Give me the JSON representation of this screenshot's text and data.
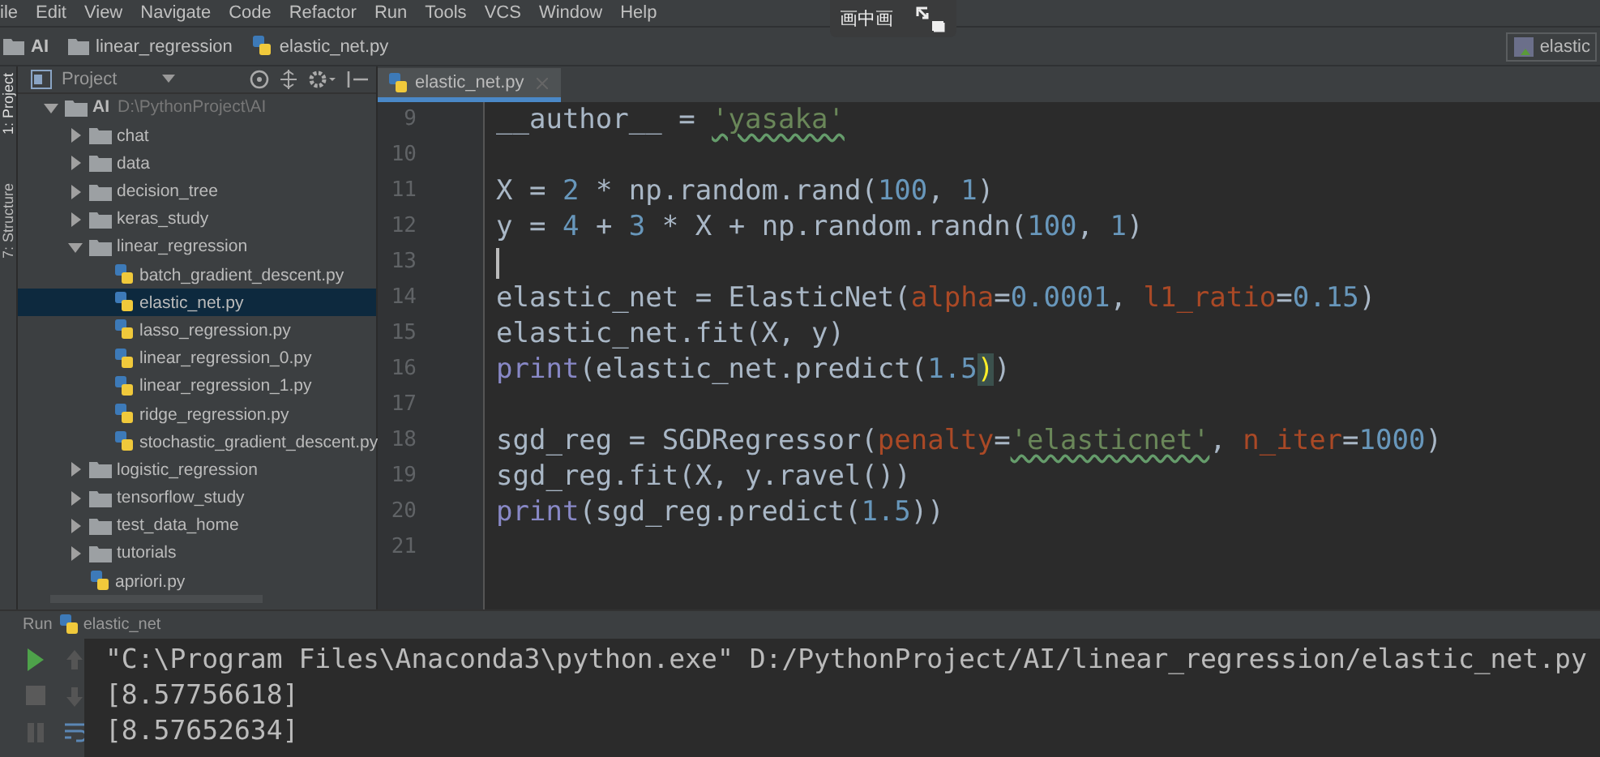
{
  "menu_bar": [
    "ile",
    "Edit",
    "View",
    "Navigate",
    "Code",
    "Refactor",
    "Run",
    "Tools",
    "VCS",
    "Window",
    "Help"
  ],
  "overlay": {
    "label": "画中画"
  },
  "breadcrumbs": [
    {
      "kind": "folder",
      "label": "AI"
    },
    {
      "kind": "folder",
      "label": "linear_regression"
    },
    {
      "kind": "file",
      "label": "elastic_net.py"
    }
  ],
  "run_config": {
    "label": "elastic"
  },
  "side_tabs": [
    "1: Project",
    "7: Structure"
  ],
  "project_panel": {
    "title": "Project",
    "tree": [
      {
        "kind": "folder",
        "label": "AI",
        "path": "D:\\PythonProject\\AI",
        "expanded": true,
        "selected": false,
        "children": [
          {
            "kind": "folder",
            "label": "chat",
            "expanded": false,
            "selected": false
          },
          {
            "kind": "folder",
            "label": "data",
            "expanded": false,
            "selected": false
          },
          {
            "kind": "folder",
            "label": "decision_tree",
            "expanded": false,
            "selected": false
          },
          {
            "kind": "folder",
            "label": "keras_study",
            "expanded": false,
            "selected": false
          },
          {
            "kind": "folder",
            "label": "linear_regression",
            "expanded": true,
            "selected": false,
            "children": [
              {
                "kind": "file",
                "label": "batch_gradient_descent.py",
                "selected": false
              },
              {
                "kind": "file",
                "label": "elastic_net.py",
                "selected": true
              },
              {
                "kind": "file",
                "label": "lasso_regression.py",
                "selected": false
              },
              {
                "kind": "file",
                "label": "linear_regression_0.py",
                "selected": false
              },
              {
                "kind": "file",
                "label": "linear_regression_1.py",
                "selected": false
              },
              {
                "kind": "file",
                "label": "ridge_regression.py",
                "selected": false
              },
              {
                "kind": "file",
                "label": "stochastic_gradient_descent.py",
                "selected": false
              }
            ]
          },
          {
            "kind": "folder",
            "label": "logistic_regression",
            "expanded": false,
            "selected": false
          },
          {
            "kind": "folder",
            "label": "tensorflow_study",
            "expanded": false,
            "selected": false
          },
          {
            "kind": "folder",
            "label": "test_data_home",
            "expanded": false,
            "selected": false
          },
          {
            "kind": "folder",
            "label": "tutorials",
            "expanded": false,
            "selected": false
          },
          {
            "kind": "file",
            "label": "apriori.py",
            "selected": false
          }
        ]
      }
    ]
  },
  "editor": {
    "tabs": [
      {
        "label": "elastic_net.py",
        "selected": true
      }
    ],
    "lines": [
      {
        "number": "9",
        "tokens": [
          {
            "kind": "plain",
            "text": "__author__ = "
          },
          {
            "kind": "typo-string",
            "text": "'yasaka'"
          }
        ]
      },
      {
        "number": "10"
      },
      {
        "number": "11",
        "tokens": [
          {
            "kind": "plain",
            "text": "X = "
          },
          {
            "kind": "number",
            "text": "2"
          },
          {
            "kind": "plain",
            "text": " * np.random.rand("
          },
          {
            "kind": "number",
            "text": "100"
          },
          {
            "kind": "plain",
            "text": ", "
          },
          {
            "kind": "number",
            "text": "1"
          },
          {
            "kind": "plain",
            "text": ")"
          }
        ]
      },
      {
        "number": "12",
        "tokens": [
          {
            "kind": "plain",
            "text": "y = "
          },
          {
            "kind": "number",
            "text": "4"
          },
          {
            "kind": "plain",
            "text": " + "
          },
          {
            "kind": "number",
            "text": "3"
          },
          {
            "kind": "plain",
            "text": " * X + np.random.randn("
          },
          {
            "kind": "number",
            "text": "100"
          },
          {
            "kind": "plain",
            "text": ", "
          },
          {
            "kind": "number",
            "text": "1"
          },
          {
            "kind": "plain",
            "text": ")"
          }
        ]
      },
      {
        "number": "13",
        "caret": true
      },
      {
        "number": "14",
        "tokens": [
          {
            "kind": "plain",
            "text": "elastic_net = ElasticNet("
          },
          {
            "kind": "keyword-arg",
            "text": "alpha"
          },
          {
            "kind": "plain",
            "text": "="
          },
          {
            "kind": "number",
            "text": "0.0001"
          },
          {
            "kind": "plain",
            "text": ", "
          },
          {
            "kind": "keyword-arg",
            "text": "l1_ratio"
          },
          {
            "kind": "plain",
            "text": "="
          },
          {
            "kind": "number",
            "text": "0.15"
          },
          {
            "kind": "plain",
            "text": ")"
          }
        ]
      },
      {
        "number": "15",
        "tokens": [
          {
            "kind": "plain",
            "text": "elastic_net.fit(X, y)"
          }
        ]
      },
      {
        "number": "16",
        "tokens": [
          {
            "kind": "builtin",
            "text": "print"
          },
          {
            "kind": "plain",
            "text": "(elastic_net.predict("
          },
          {
            "kind": "number",
            "text": "1.5"
          },
          {
            "kind": "brace-match",
            "text": ")"
          },
          {
            "kind": "plain",
            "text": ")"
          }
        ]
      },
      {
        "number": "17"
      },
      {
        "number": "18",
        "tokens": [
          {
            "kind": "plain",
            "text": "sgd_reg = SGDRegressor("
          },
          {
            "kind": "keyword-arg",
            "text": "penalty"
          },
          {
            "kind": "plain",
            "text": "="
          },
          {
            "kind": "typo-string",
            "text": "'elasticnet'"
          },
          {
            "kind": "plain",
            "text": ", "
          },
          {
            "kind": "keyword-arg",
            "text": "n_iter"
          },
          {
            "kind": "plain",
            "text": "="
          },
          {
            "kind": "number",
            "text": "1000"
          },
          {
            "kind": "plain",
            "text": ")"
          }
        ]
      },
      {
        "number": "19",
        "tokens": [
          {
            "kind": "plain",
            "text": "sgd_reg.fit(X, y.ravel())"
          }
        ]
      },
      {
        "number": "20",
        "tokens": [
          {
            "kind": "builtin",
            "text": "print"
          },
          {
            "kind": "plain",
            "text": "(sgd_reg.predict("
          },
          {
            "kind": "number",
            "text": "1.5"
          },
          {
            "kind": "plain",
            "text": "))"
          }
        ]
      },
      {
        "number": "21"
      }
    ]
  },
  "run_panel": {
    "label": "Run",
    "config": "elastic_net",
    "output": [
      "\"C:\\Program Files\\Anaconda3\\python.exe\" D:/PythonProject/AI/linear_regression/elastic_net.py",
      "[8.57756618]",
      "[8.57652634]"
    ]
  }
}
